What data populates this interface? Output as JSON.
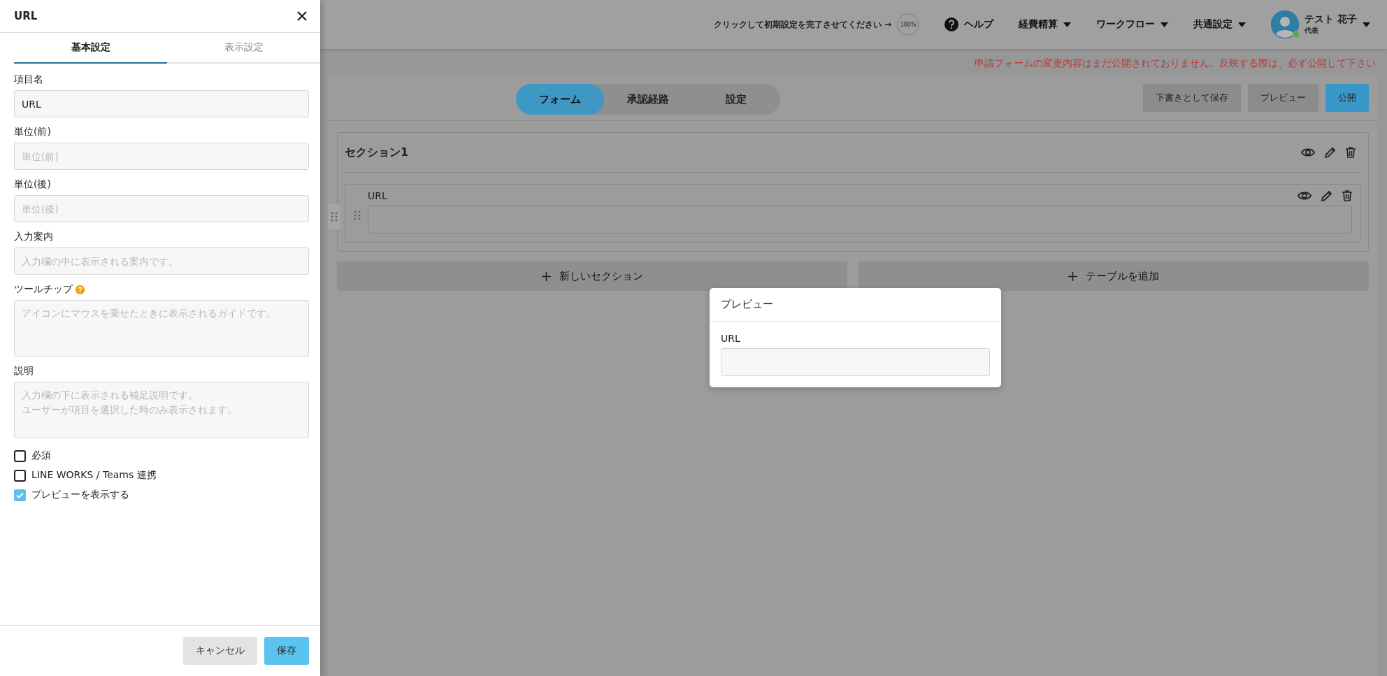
{
  "settings_panel": {
    "title": "URL",
    "tabs": [
      {
        "label": "基本設定",
        "selected": true
      },
      {
        "label": "表示設定",
        "selected": false
      }
    ],
    "fields": [
      {
        "kind": "input",
        "label": "項目名",
        "value": "URL",
        "help": false
      },
      {
        "kind": "input",
        "label": "単位(前)",
        "placeholder": "単位(前)",
        "help": false
      },
      {
        "kind": "input",
        "label": "単位(後)",
        "placeholder": "単位(後)",
        "help": false
      },
      {
        "kind": "input",
        "label": "入力案内",
        "placeholder": "入力欄の中に表示される案内です。",
        "help": false
      },
      {
        "kind": "textarea",
        "label": "ツールチップ",
        "placeholder": "アイコンにマウスを乗せたときに表示されるガイドです。",
        "help": true
      },
      {
        "kind": "textarea_lines",
        "label": "説明",
        "placeholder_lines": [
          "入力欄の下に表示される補足説明です。",
          "ユーザーが項目を選択した時のみ表示されます。"
        ],
        "help": false
      }
    ],
    "checkboxes": [
      {
        "label": "必須",
        "checked": false
      },
      {
        "label": "LINE WORKS / Teams 連携",
        "checked": false
      },
      {
        "label": "プレビューを表示する",
        "checked": true
      }
    ],
    "buttons": [
      {
        "label": "キャンセル",
        "kind": "secondary"
      },
      {
        "label": "保存",
        "kind": "primary"
      }
    ]
  },
  "top_bar": {
    "setup_prompt": "クリックして初期設定を完了させてください →",
    "progress": "100%",
    "menus": [
      {
        "label": "ヘルプ",
        "kind": "help"
      },
      {
        "label": "経費精算",
        "kind": "dropdown"
      },
      {
        "label": "ワークフロー",
        "kind": "dropdown"
      },
      {
        "label": "共通設定",
        "kind": "dropdown"
      }
    ],
    "user": {
      "name": "テスト 花子",
      "role": "代表",
      "online": true
    }
  },
  "notice": "申請フォームの変更内容はまだ公開されておりません。反映する際は、必ず公開して下さい",
  "editor_tabs": [
    {
      "label": "フォーム",
      "selected": true
    },
    {
      "label": "承認経路",
      "selected": false
    },
    {
      "label": "設定",
      "selected": false
    }
  ],
  "actions": [
    {
      "label": "下書きとして保存",
      "kind": "secondary"
    },
    {
      "label": "プレビュー",
      "kind": "secondary"
    },
    {
      "label": "公開",
      "kind": "primary"
    }
  ],
  "section": {
    "title": "セクション1",
    "fields": [
      {
        "label": "URL"
      }
    ]
  },
  "add_buttons": [
    {
      "label": "新しいセクション"
    },
    {
      "label": "テーブルを追加"
    }
  ],
  "preview_modal": {
    "title": "プレビュー",
    "fields": [
      {
        "label": "URL"
      }
    ]
  }
}
